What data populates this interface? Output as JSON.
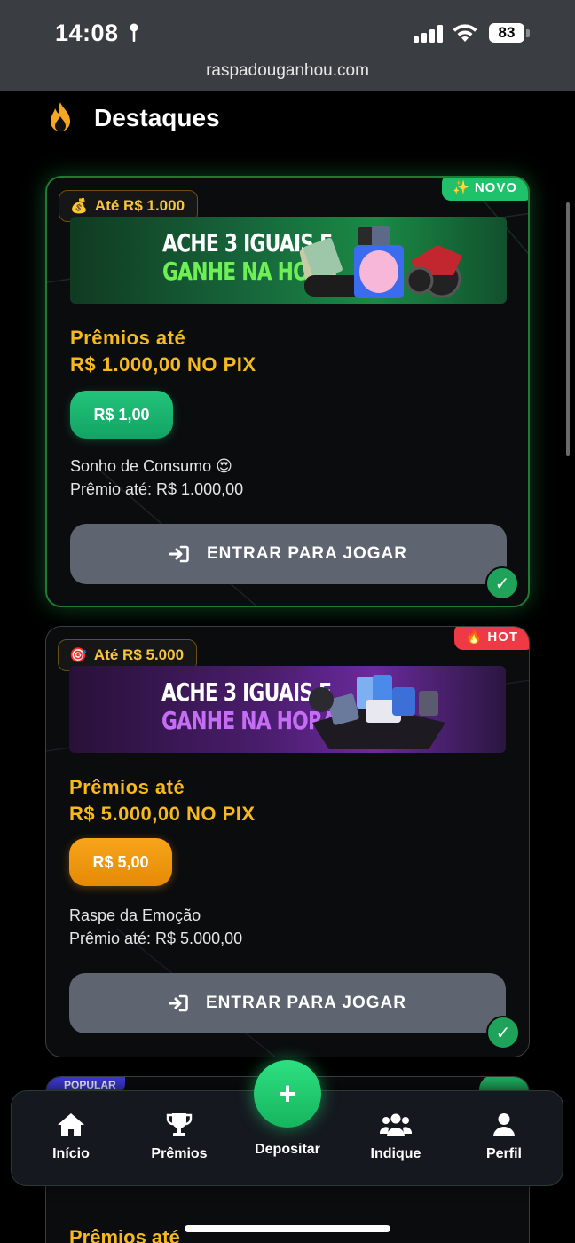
{
  "status_bar": {
    "time": "14:08",
    "battery": "83"
  },
  "browser": {
    "url": "raspadouganhou.com"
  },
  "section": {
    "title": "Destaques",
    "icon": "flame-icon"
  },
  "cards": [
    {
      "badge": "Até R$ 1.000",
      "badge_icon": "money-bag-icon",
      "tag": "✨ NOVO",
      "banner_line1": "ACHE 3 IGUAIS E",
      "banner_line2": "GANHE NA HORA",
      "prize_line1": "Prêmios até",
      "prize_line2": "R$ 1.000,00 NO PIX",
      "price": "R$ 1,00",
      "name": "Sonho de Consumo 😍",
      "max_prize": "Prêmio até: R$ 1.000,00",
      "button": "ENTRAR PARA JOGAR"
    },
    {
      "badge": "Até R$ 5.000",
      "badge_icon": "target-icon",
      "tag": "🔥 HOT",
      "banner_line1": "ACHE 3 IGUAIS E",
      "banner_line2": "GANHE NA HORA",
      "prize_line1": "Prêmios até",
      "prize_line2": "R$ 5.000,00 NO PIX",
      "price": "R$ 5,00",
      "name": "Raspe da Emoção",
      "max_prize": "Prêmio até: R$ 5.000,00",
      "button": "ENTRAR PARA JOGAR"
    },
    {
      "tag": "POPULAR",
      "prize_line1": "Prêmios até"
    }
  ],
  "nav": {
    "home": "Início",
    "prizes": "Prêmios",
    "deposit": "Depositar",
    "refer": "Indique",
    "profile": "Perfil"
  },
  "colors": {
    "accent_green": "#1fc26b",
    "prize_gold": "#f6b91e",
    "hot_red": "#ef3944"
  }
}
